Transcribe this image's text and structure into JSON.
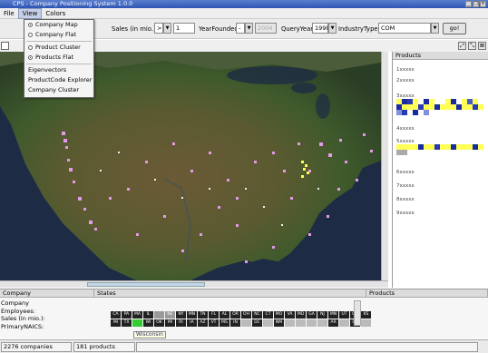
{
  "window": {
    "title": "CPS - Company Positioning System 1.0.0"
  },
  "menubar": {
    "items": [
      "File",
      "View",
      "Colors"
    ]
  },
  "view_menu": {
    "items": [
      {
        "label": "Company Map",
        "radio": true,
        "selected": true
      },
      {
        "label": "Company Flat",
        "radio": true,
        "selected": false
      },
      {
        "label": "Product Cluster",
        "radio": true,
        "selected": false
      },
      {
        "label": "Products Flat",
        "radio": true,
        "selected": true
      },
      {
        "label": "Eigenvectors",
        "radio": false
      },
      {
        "label": "ProductCode Explorer",
        "radio": false
      },
      {
        "label": "Company Cluster",
        "radio": false
      }
    ]
  },
  "toolbar": {
    "sales_label": "Sales (in mio.):",
    "sales_op": ">",
    "sales_value": "1",
    "year_founded_label": "YearFounded:",
    "year_founded_op": "-",
    "year_founded_value": "2004",
    "query_year_label": "QueryYear:",
    "query_year_value": "1998",
    "industry_type_label": "IndustryType:",
    "industry_type_value": "COM",
    "go_label": "go!"
  },
  "products_panel": {
    "title": "Products",
    "rows": [
      "1xxxxx",
      "2xxxxx",
      "3xxxxx",
      "4xxxxx",
      "5xxxxx",
      "6xxxxx",
      "7xxxxx",
      "8xxxxx",
      "9xxxxx"
    ]
  },
  "bottom": {
    "company_header": "Company",
    "states_header": "States",
    "products_header": "Products",
    "company_fields": [
      "Company",
      "Employees:",
      "Sales (in mio.):",
      "PrimaryNAICS:"
    ],
    "states_row1": [
      "CA",
      "PA",
      "MA",
      "IL",
      "",
      "NE",
      "NY",
      "MN",
      "TN",
      "FL",
      "AL",
      "OR",
      "OH",
      "NC",
      "CT",
      "MO",
      "VA",
      "MD",
      "GA",
      "NJ",
      "MN",
      "UT",
      "CO",
      "KS"
    ],
    "states_row2": [
      "MI",
      "TX",
      "",
      "WI",
      "OK",
      "MI",
      "RI",
      "IA",
      "AZ",
      "VT",
      "MS",
      "IN",
      "",
      "DC",
      "",
      "NM",
      "",
      "",
      "",
      "",
      "AR",
      "",
      "DE",
      ""
    ],
    "tooltip": "Wisconsin"
  },
  "status": {
    "companies": "2276 companies",
    "products": "181 products"
  },
  "colors": {
    "accent": "#2f55b3",
    "point": "#e39ae8",
    "highlight": "#ffff55"
  }
}
